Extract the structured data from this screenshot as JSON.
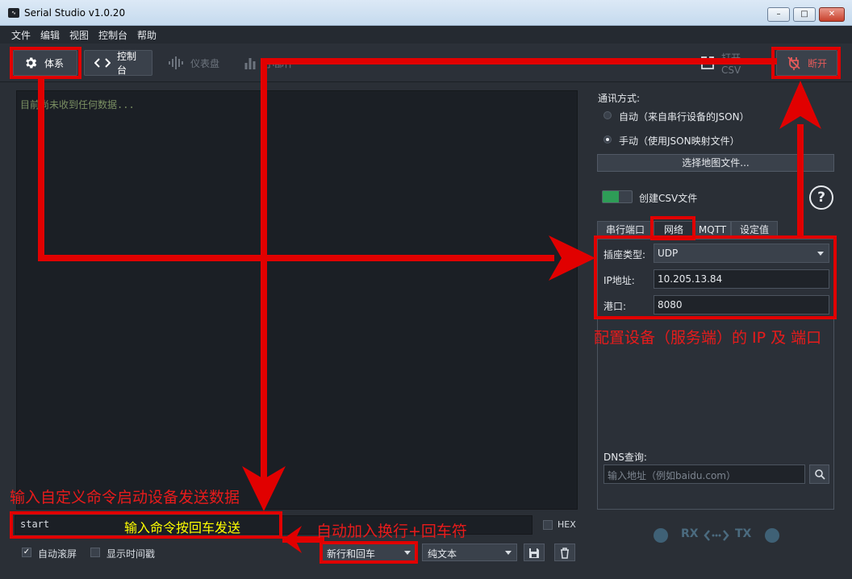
{
  "window": {
    "title": "Serial Studio v1.0.20",
    "icon": "app-icon",
    "min": "–",
    "max": "□",
    "close": "✕"
  },
  "menu": [
    "文件",
    "编辑",
    "视图",
    "控制台",
    "帮助"
  ],
  "toolbar": {
    "setup": "体系",
    "console": "控制台",
    "dashboard": "仪表盘",
    "widgets": "小部件",
    "open_csv": "打开CSV",
    "disconnect": "断开"
  },
  "console": {
    "text": "目前尚未收到任何数据...",
    "input_value": "start",
    "hex_label": "HEX",
    "autoscroll_label": "自动滚屏",
    "autoscroll_checked": true,
    "timestamp_label": "显示时间戳",
    "timestamp_checked": false,
    "line_ending": "新行和回车",
    "display_mode": "纯文本"
  },
  "setup": {
    "comm_mode_label": "通讯方式:",
    "mode_auto": "自动（来自串行设备的JSON）",
    "mode_manual": "手动（使用JSON映射文件）",
    "selected_mode": "manual",
    "select_map_button": "选择地图文件...",
    "csv_toggle_label": "创建CSV文件",
    "csv_toggle_on": true,
    "help_icon": "?",
    "tabs": [
      "串行端口",
      "网络",
      "MQTT",
      "设定值"
    ],
    "active_tab": "网络",
    "network": {
      "socket_type_label": "插座类型:",
      "socket_type": "UDP",
      "ip_label": "IP地址:",
      "ip": "10.205.13.84",
      "port_label": "港口:",
      "port": "8080",
      "dns_label": "DNS查询:",
      "dns_placeholder": "输入地址（例如baidu.com）"
    },
    "rx_label": "RX",
    "tx_label": "TX"
  },
  "annotations": {
    "config_device": "配置设备（服务端）的 IP 及 端口",
    "input_custom": "输入自定义命令启动设备发送数据",
    "press_enter": "输入命令按回车发送",
    "auto_newline": "自动加入换行+回车符"
  },
  "colors": {
    "annotation_red": "#e10000",
    "annotation_yellow": "#ffff00",
    "toggle_green": "#2e9d57"
  }
}
